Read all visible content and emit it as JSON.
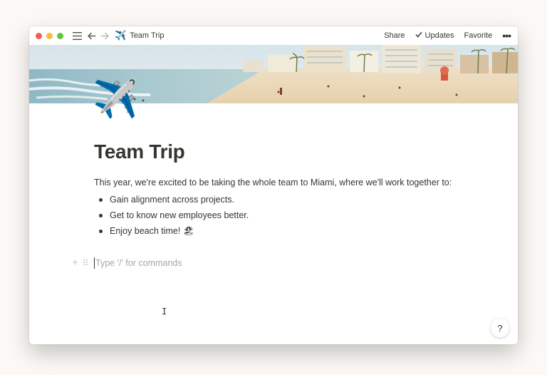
{
  "titlebar": {
    "page_emoji": "✈️",
    "page_title": "Team Trip",
    "share_label": "Share",
    "updates_label": "Updates",
    "favorite_label": "Favorite",
    "more_label": "•••"
  },
  "icons": {
    "menu": "hamburger-icon",
    "back": "arrow-left-icon",
    "forward": "arrow-right-icon",
    "check": "check-icon",
    "more": "more-icon",
    "plus": "plus-icon",
    "drag": "drag-handle-icon",
    "help": "question-icon"
  },
  "page": {
    "icon": "✈️",
    "title": "Team Trip",
    "intro": "This year, we're excited to be taking the whole team to Miami, where we'll work together to:",
    "bullets": [
      "Gain alignment across projects.",
      "Get to know new employees better.",
      "Enjoy beach time! 🏖"
    ],
    "command_placeholder": "Type '/' for commands"
  },
  "help": {
    "label": "?"
  },
  "colors": {
    "text": "#37352f",
    "muted": "#a8a6a1",
    "close": "#ee5f57",
    "minimize": "#f6be3b",
    "zoom": "#5ec63f"
  }
}
